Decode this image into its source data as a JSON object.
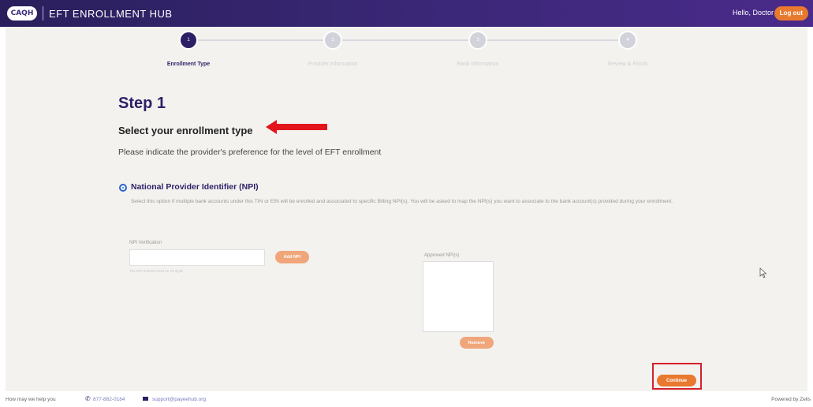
{
  "header": {
    "logo_text": "CAQH",
    "title": "EFT ENROLLMENT HUB",
    "greeting": "Hello, Doctor",
    "logout_label": "Log out"
  },
  "stepper": {
    "steps": [
      {
        "number": "1",
        "label": "Enrollment Type",
        "active": true
      },
      {
        "number": "2",
        "label": "Provider Information",
        "active": false
      },
      {
        "number": "3",
        "label": "Bank Information",
        "active": false
      },
      {
        "number": "4",
        "label": "Review & Finish",
        "active": false
      }
    ]
  },
  "main": {
    "step_title": "Step 1",
    "section_title": "Select your enrollment type",
    "description": "Please indicate the provider's preference for the level of EFT enrollment",
    "option": {
      "label": "National Provider Identifier (NPI)",
      "description": "Select this option if multiple bank accounts under this TIN or EIN will be enrolled and associated to specific Billing NPI(s). You will be asked to map the NPI(s) you want to associate to the bank account(s) provided during your enrollment.",
      "selected": true
    },
    "npi_verification": {
      "label": "NPI Verification",
      "value": "",
      "hint": "The NPI entered must be 10 digits",
      "add_button_label": "Add NPI"
    },
    "approved": {
      "label": "Approved NPI(s)",
      "remove_button_label": "Remove"
    },
    "continue_label": "Continue"
  },
  "footer": {
    "help_text": "How may we help you",
    "phone": "877-882-0184",
    "email": "support@payeehub.org",
    "powered_by": "Powered by Zelis"
  },
  "colors": {
    "brand_purple": "#2d1f66",
    "accent_orange": "#e9792f",
    "highlight_red": "#d7202a"
  }
}
